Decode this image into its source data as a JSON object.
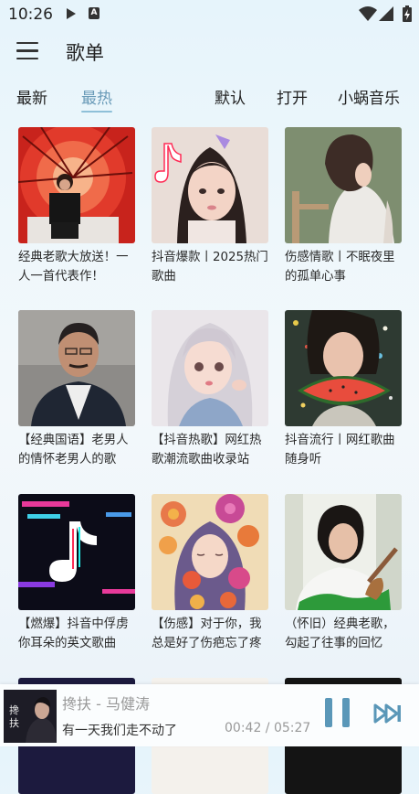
{
  "status": {
    "time": "10:26"
  },
  "header": {
    "title": "歌单"
  },
  "tabs": [
    {
      "label": "最新"
    },
    {
      "label": "最热"
    },
    {
      "label": "默认"
    },
    {
      "label": "打开"
    },
    {
      "label": "小蜗音乐"
    }
  ],
  "playlists": [
    {
      "title": "经典老歌大放送！一人一首代表作！"
    },
    {
      "title": "抖音爆款丨2025热门歌曲"
    },
    {
      "title": "伤感情歌丨不眠夜里的孤单心事"
    },
    {
      "title": "【经典国语】老男人的情怀老男人的歌"
    },
    {
      "title": "【抖音热歌】网红热歌潮流歌曲收录站"
    },
    {
      "title": "抖音流行丨网红歌曲随身听"
    },
    {
      "title": "【燃爆】抖音中俘虏你耳朵的英文歌曲"
    },
    {
      "title": "【伤感】对于你，我总是好了伤疤忘了疼"
    },
    {
      "title": "（怀旧）经典老歌，勾起了往事的回忆"
    }
  ],
  "player": {
    "song": "搀扶 - 马健涛",
    "lyric": "有一天我们走不动了",
    "time": "00:42 / 05:27",
    "progress": 0.128,
    "accent_color": "#5a97b8"
  }
}
